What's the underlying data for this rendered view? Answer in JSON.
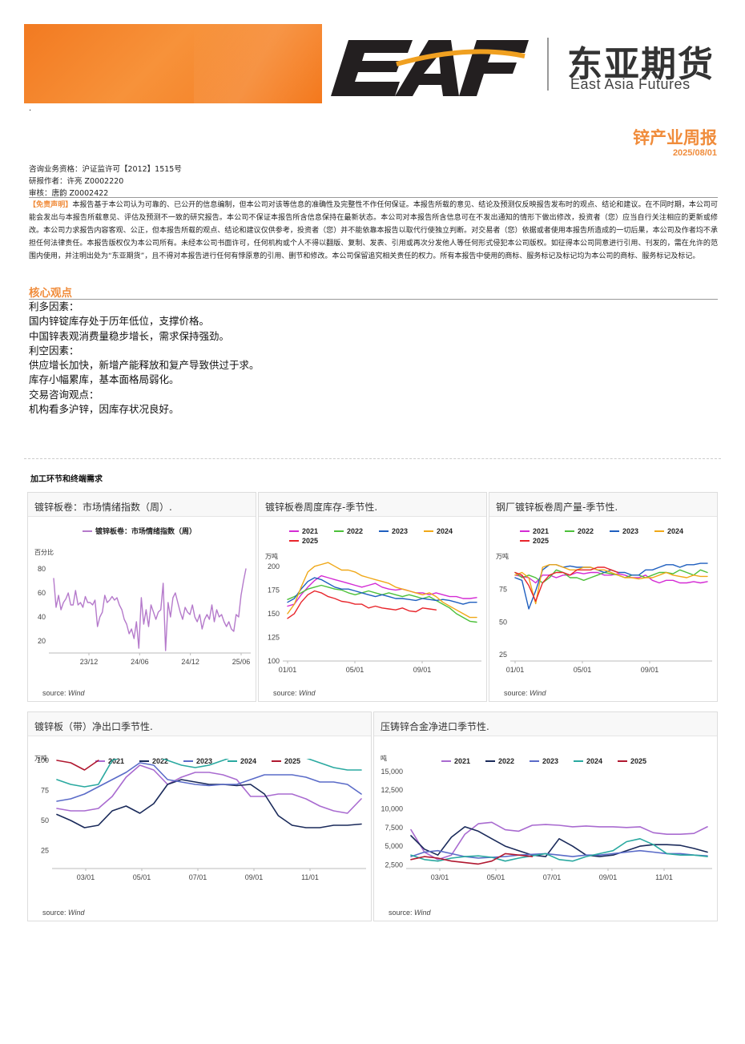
{
  "header": {
    "logo_text": "EAF",
    "logo_cn": "东亚期货",
    "logo_en": "East Asia Futures",
    "dot": "."
  },
  "report": {
    "title": "锌产业周报",
    "date": "2025/08/01"
  },
  "meta": {
    "license": "咨询业务资格：沪证监许可【2012】1515号",
    "author": "研报作者：许亮 Z0002220",
    "reviewer": "审核：唐韵 Z0002422"
  },
  "disclaimer": {
    "tag": "【免责声明】",
    "text": "本报告基于本公司认为可靠的、已公开的信息编制，但本公司对该等信息的准确性及完整性不作任何保证。本报告所载的意见、结论及预测仅反映报告发布时的观点、结论和建议。在不同时期，本公司可能会发出与本报告所载意见、评估及预测不一致的研究报告。本公司不保证本报告所含信息保持在最新状态。本公司对本报告所含信息可在不发出通知的情形下做出修改，投资者（您）应当自行关注相应的更新或修改。本公司力求报告内容客观、公正，但本报告所载的观点、结论和建议仅供参考，投资者（您）并不能依靠本报告以取代行使独立判断。对交易者（您）依据或者使用本报告所造成的一切后果，本公司及作者均不承担任何法律责任。本报告版权仅为本公司所有。未经本公司书面许可，任何机构或个人不得以翻版、复制、发表、引用或再次分发他人等任何形式侵犯本公司版权。如征得本公司同意进行引用、刊发的，需在允许的范围内使用，并注明出处为“东亚期货”，且不得对本报告进行任何有悖原意的引用、删节和修改。本公司保留追究相关责任的权力。所有本报告中使用的商标、服务标记及标记均为本公司的商标、服务标记及标记。"
  },
  "core": {
    "title": "核心观点",
    "lines": [
      "利多因素：",
      "国内锌锭库存处于历年低位，支撑价格。",
      "中国锌表观消费量稳步增长，需求保持强劲。",
      "利空因素：",
      "供应增长加快，新增产能释放和复产导致供过于求。",
      "库存小幅累库，基本面格局弱化。",
      "交易咨询观点：",
      "机构看多沪锌，因库存状况良好。"
    ]
  },
  "section_label": "加工环节和终端需求",
  "source": {
    "label": "source:",
    "name": "Wind"
  },
  "colors": {
    "orange": "#f08c3b",
    "y2021_a": "#d42bd4",
    "y2022_a": "#4cc03a",
    "y2023_a": "#1f5fbf",
    "y2024_a": "#f0a818",
    "y2025_a": "#e8252b",
    "y2021_b": "#a96bd0",
    "y2022_b": "#1a2a5a",
    "y2023_b": "#5a6bc8",
    "y2024_b": "#2aa9a0",
    "y2025_b": "#b01830"
  },
  "chart_data": [
    {
      "id": "c1",
      "type": "line",
      "title": "镀锌板卷：市场情绪指数（周）.",
      "ylabel": "百分比",
      "ylim": [
        10,
        90
      ],
      "yticks": [
        20,
        40,
        60,
        80
      ],
      "x_ticks": [
        "23/12",
        "24/06",
        "24/12",
        "25/06"
      ],
      "legend": "top",
      "series": [
        {
          "name": "镀锌板卷：市场情绪指数（周）",
          "color": "#b57acb",
          "values": [
            72,
            48,
            58,
            46,
            52,
            55,
            60,
            50,
            50,
            62,
            50,
            52,
            48,
            57,
            52,
            52,
            50,
            54,
            32,
            40,
            44,
            58,
            52,
            54,
            57,
            54,
            56,
            50,
            46,
            38,
            34,
            26,
            30,
            22,
            36,
            14,
            56,
            34,
            46,
            32,
            50,
            44,
            38,
            44,
            46,
            68,
            12,
            52,
            40,
            56,
            60,
            52,
            44,
            38,
            48,
            44,
            42,
            50,
            40,
            36,
            42,
            30,
            38,
            42,
            38,
            50,
            36,
            46,
            40,
            42,
            36,
            32,
            36,
            30,
            28,
            42,
            40,
            58,
            70,
            80
          ]
        }
      ]
    },
    {
      "id": "c2",
      "type": "line",
      "title": "镀锌板卷周度库存-季节性.",
      "ylabel": "万吨",
      "ylim": [
        100,
        210
      ],
      "yticks": [
        100,
        125,
        150,
        175,
        200
      ],
      "x_ticks": [
        "01/01",
        "05/01",
        "09/01"
      ],
      "legend": "top",
      "series": [
        {
          "name": "2021",
          "color": "#d42bd4",
          "values": [
            158,
            160,
            170,
            178,
            185,
            190,
            188,
            186,
            184,
            182,
            180,
            178,
            180,
            182,
            178,
            176,
            175,
            176,
            174,
            172,
            172,
            170,
            172,
            170,
            168,
            168,
            166,
            166,
            167
          ]
        },
        {
          "name": "2022",
          "color": "#4cc03a",
          "values": [
            165,
            168,
            172,
            176,
            178,
            180,
            178,
            176,
            175,
            172,
            170,
            172,
            174,
            172,
            170,
            172,
            170,
            168,
            170,
            168,
            166,
            168,
            164,
            160,
            156,
            150,
            146,
            142,
            141
          ]
        },
        {
          "name": "2023",
          "color": "#1f5fbf",
          "values": [
            162,
            166,
            176,
            184,
            188,
            186,
            182,
            178,
            176,
            176,
            174,
            172,
            170,
            168,
            170,
            168,
            166,
            166,
            165,
            164,
            166,
            165,
            164,
            165,
            164,
            162,
            160,
            162,
            162
          ]
        },
        {
          "name": "2024",
          "color": "#f0a818",
          "values": [
            150,
            160,
            178,
            194,
            200,
            202,
            204,
            200,
            196,
            196,
            194,
            190,
            188,
            186,
            184,
            182,
            178,
            176,
            174,
            172,
            170,
            172,
            168,
            162,
            158,
            154,
            150,
            146,
            146
          ]
        },
        {
          "name": "2025",
          "color": "#e8252b",
          "values": [
            145,
            150,
            162,
            170,
            174,
            172,
            168,
            166,
            163,
            162,
            160,
            160,
            156,
            158,
            156,
            155,
            154,
            156,
            153,
            152,
            156,
            155,
            154,
            null,
            null,
            null,
            null,
            null,
            null
          ]
        }
      ]
    },
    {
      "id": "c3",
      "type": "line",
      "title": "钢厂镀锌板卷周产量-季节性.",
      "ylabel": "万吨",
      "ylim": [
        20,
        100
      ],
      "yticks": [
        25,
        50,
        75
      ],
      "x_ticks": [
        "01/01",
        "05/01",
        "09/01"
      ],
      "legend": "top",
      "series": [
        {
          "name": "2021",
          "color": "#d42bd4",
          "values": [
            86,
            85,
            84,
            80,
            86,
            86,
            84,
            86,
            86,
            88,
            87,
            88,
            88,
            86,
            86,
            87,
            86,
            84,
            84,
            86,
            82,
            80,
            82,
            82,
            80,
            80,
            81,
            80,
            81
          ]
        },
        {
          "name": "2022",
          "color": "#4cc03a",
          "values": [
            88,
            84,
            86,
            84,
            80,
            84,
            90,
            88,
            84,
            84,
            82,
            84,
            86,
            88,
            87,
            86,
            84,
            86,
            86,
            84,
            86,
            88,
            88,
            87,
            90,
            88,
            86,
            90,
            88
          ]
        },
        {
          "name": "2023",
          "color": "#1f5fbf",
          "values": [
            84,
            82,
            60,
            74,
            90,
            94,
            94,
            92,
            93,
            92,
            92,
            92,
            90,
            88,
            90,
            88,
            88,
            86,
            86,
            90,
            90,
            92,
            94,
            94,
            92,
            94,
            94,
            95,
            95
          ]
        },
        {
          "name": "2024",
          "color": "#f0a818",
          "values": [
            86,
            88,
            84,
            64,
            92,
            94,
            94,
            92,
            90,
            90,
            92,
            92,
            90,
            90,
            88,
            86,
            84,
            84,
            83,
            84,
            84,
            86,
            88,
            86,
            85,
            84,
            86,
            85,
            85
          ]
        },
        {
          "name": "2025",
          "color": "#e8252b",
          "values": [
            88,
            86,
            78,
            66,
            80,
            86,
            88,
            88,
            86,
            90,
            90,
            90,
            92,
            92,
            90,
            88,
            null,
            null,
            null,
            null,
            null,
            null,
            null,
            null,
            null,
            null,
            null,
            null,
            null
          ]
        }
      ]
    },
    {
      "id": "c4",
      "type": "line",
      "title": "镀锌板（带）净出口季节性.",
      "ylabel": "万吨",
      "ylim": [
        10,
        100
      ],
      "yticks": [
        25,
        50,
        75,
        100
      ],
      "x_ticks": [
        "03/01",
        "05/01",
        "07/01",
        "09/01",
        "11/01"
      ],
      "legend": "top",
      "series": [
        {
          "name": "2021",
          "color": "#a96bd0",
          "values": [
            60,
            58,
            58,
            60,
            70,
            86,
            96,
            92,
            80,
            86,
            90,
            90,
            88,
            84,
            70,
            70,
            72,
            72,
            68,
            62,
            58,
            56,
            68
          ]
        },
        {
          "name": "2022",
          "color": "#1a2a5a",
          "values": [
            55,
            50,
            44,
            46,
            58,
            62,
            56,
            64,
            80,
            84,
            82,
            80,
            80,
            79,
            80,
            72,
            54,
            46,
            44,
            44,
            46,
            46,
            47
          ]
        },
        {
          "name": "2023",
          "color": "#5a6bc8",
          "values": [
            66,
            68,
            72,
            78,
            84,
            90,
            98,
            96,
            84,
            82,
            80,
            79,
            80,
            80,
            84,
            88,
            88,
            88,
            86,
            82,
            82,
            80,
            72
          ]
        },
        {
          "name": "2024",
          "color": "#2aa9a0",
          "values": [
            84,
            80,
            78,
            80,
            100,
            104,
            106,
            104,
            100,
            96,
            94,
            96,
            100,
            104,
            108,
            112,
            110,
            106,
            102,
            98,
            94,
            92,
            92
          ]
        },
        {
          "name": "2025",
          "color": "#b01830",
          "values": [
            100,
            98,
            92,
            100,
            null,
            null,
            null,
            null,
            null,
            null,
            null,
            null,
            null,
            null,
            null,
            null,
            null,
            null,
            null,
            null,
            null,
            null,
            null
          ]
        }
      ]
    },
    {
      "id": "c5",
      "type": "line",
      "title": "压铸锌合金净进口季节性.",
      "ylabel": "吨",
      "ylim": [
        2000,
        16500
      ],
      "yticks": [
        2500,
        5000,
        7500,
        10000,
        12500,
        15000
      ],
      "x_ticks": [
        "03/01",
        "05/01",
        "07/01",
        "09/01",
        "11/01"
      ],
      "legend": "top",
      "series": [
        {
          "name": "2021",
          "color": "#a96bd0",
          "values": [
            7200,
            4200,
            3200,
            3800,
            6600,
            8000,
            8200,
            7200,
            7000,
            7800,
            7900,
            7800,
            7600,
            7700,
            7600,
            7600,
            7500,
            7600,
            6800,
            6600,
            6600,
            6700,
            7600
          ]
        },
        {
          "name": "2022",
          "color": "#1a2a5a",
          "values": [
            6400,
            4600,
            3800,
            6200,
            7600,
            7000,
            6000,
            5000,
            4400,
            3800,
            3600,
            6000,
            5000,
            3800,
            3600,
            3800,
            4400,
            5000,
            5200,
            5200,
            5100,
            4700,
            4200
          ]
        },
        {
          "name": "2023",
          "color": "#5a6bc8",
          "values": [
            3600,
            4200,
            4400,
            4000,
            3600,
            3400,
            3500,
            3600,
            3800,
            3900,
            4000,
            3800,
            3600,
            3800,
            3800,
            4000,
            4200,
            4400,
            4200,
            4000,
            4000,
            3800,
            3700
          ]
        },
        {
          "name": "2024",
          "color": "#2aa9a0",
          "values": [
            3800,
            3200,
            3000,
            3400,
            3600,
            3700,
            3500,
            3000,
            3400,
            3700,
            4000,
            3200,
            3000,
            3600,
            4000,
            4400,
            5600,
            6000,
            5200,
            4000,
            3800,
            3800,
            3600
          ]
        },
        {
          "name": "2025",
          "color": "#b01830",
          "values": [
            3200,
            3600,
            3400,
            3000,
            2800,
            2600,
            3000,
            4000,
            3800,
            3600,
            null,
            null,
            null,
            null,
            null,
            null,
            null,
            null,
            null,
            null,
            null,
            null,
            null
          ]
        }
      ]
    }
  ]
}
